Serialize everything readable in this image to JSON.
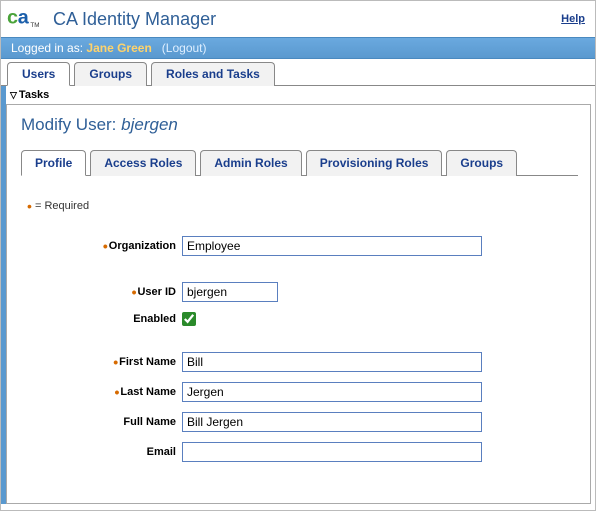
{
  "header": {
    "app_title": "CA Identity Manager",
    "help": "Help"
  },
  "login_bar": {
    "prefix": "Logged in as: ",
    "user": "Jane Green",
    "logout": "(Logout)"
  },
  "main_tabs": {
    "items": [
      "Users",
      "Groups",
      "Roles and Tasks"
    ],
    "active": 0
  },
  "tasks_label": "Tasks",
  "page": {
    "title_prefix": "Modify User: ",
    "title_user": "bjergen"
  },
  "sub_tabs": {
    "items": [
      "Profile",
      "Access Roles",
      "Admin Roles",
      "Provisioning Roles",
      "Groups"
    ],
    "active": 0
  },
  "required_note": " = Required",
  "form": {
    "organization": {
      "label": "Organization",
      "value": "Employee",
      "required": true
    },
    "user_id": {
      "label": "User ID",
      "value": "bjergen",
      "required": true
    },
    "enabled": {
      "label": "Enabled",
      "checked": true
    },
    "first_name": {
      "label": "First Name",
      "value": "Bill",
      "required": true
    },
    "last_name": {
      "label": "Last Name",
      "value": "Jergen",
      "required": true
    },
    "full_name": {
      "label": "Full Name",
      "value": "Bill Jergen",
      "required": false
    },
    "email": {
      "label": "Email",
      "value": "",
      "required": false
    }
  }
}
